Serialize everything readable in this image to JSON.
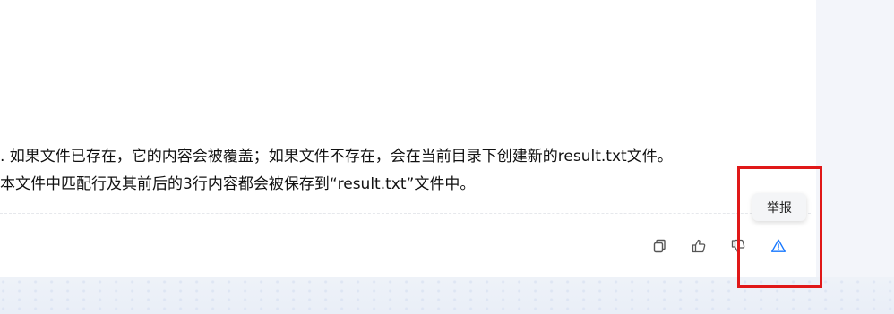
{
  "answer": {
    "line1": ". 如果文件已存在，它的内容会被覆盖；如果文件不存在，会在当前目录下创建新的result.txt文件。",
    "line2": "本文件中匹配行及其前后的3行内容都会被保存到“result.txt”文件中。"
  },
  "actions": {
    "copy_icon": "copy-icon",
    "like_icon": "thumbs-up-icon",
    "dislike_icon": "thumbs-down-icon",
    "report_icon": "warning-triangle-icon",
    "report_color": "#1677ff"
  },
  "tooltip": {
    "label": "举报"
  },
  "colors": {
    "highlight": "#e01818"
  }
}
